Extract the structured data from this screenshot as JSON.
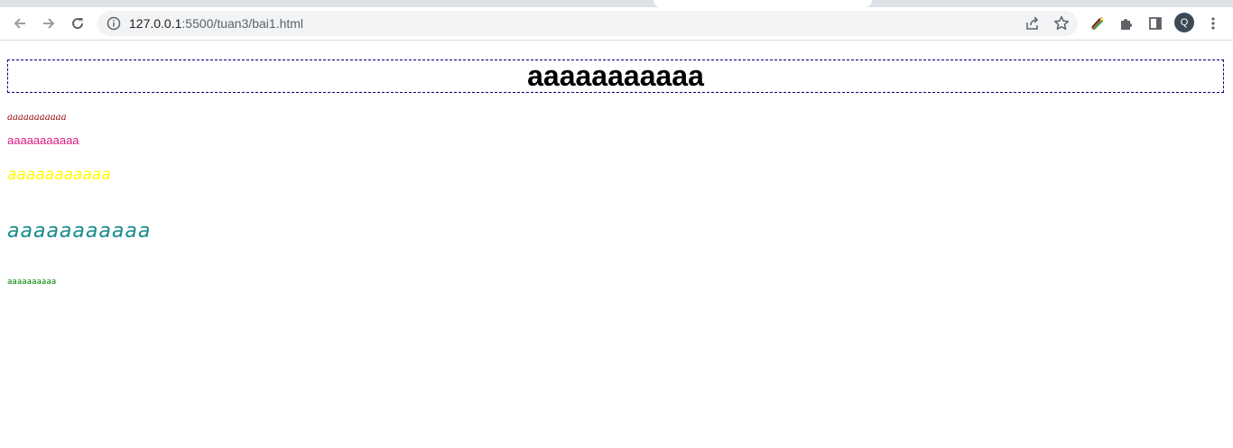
{
  "browser": {
    "url_host": "127.0.0.1",
    "url_rest": ":5500/tuan3/bai1.html",
    "profile_initial": "Q",
    "icons": {
      "back": "arrow-left-icon",
      "forward": "arrow-right-icon",
      "reload": "reload-icon",
      "site_info": "info-icon",
      "share": "share-icon",
      "bookmark": "star-icon",
      "extension_app": "colored-brush-extension-icon",
      "extensions": "puzzle-icon",
      "side_panel": "side-panel-icon",
      "menu": "three-dots-vertical-icon"
    }
  },
  "page": {
    "heading": "aaaaaaaaaaa",
    "lines": [
      "aaaaaaaaaaa",
      "aaaaaaaaaaa",
      "aaaaaaaaaaa",
      "aaaaaaaaaaa",
      "aaaaaaaaaa"
    ]
  },
  "colors": {
    "heading_border": "#000080",
    "line1": "#8b0000",
    "line2": "#d81b80",
    "line3": "#ffff00",
    "line4": "#1a8c8c",
    "line5": "#008000"
  }
}
